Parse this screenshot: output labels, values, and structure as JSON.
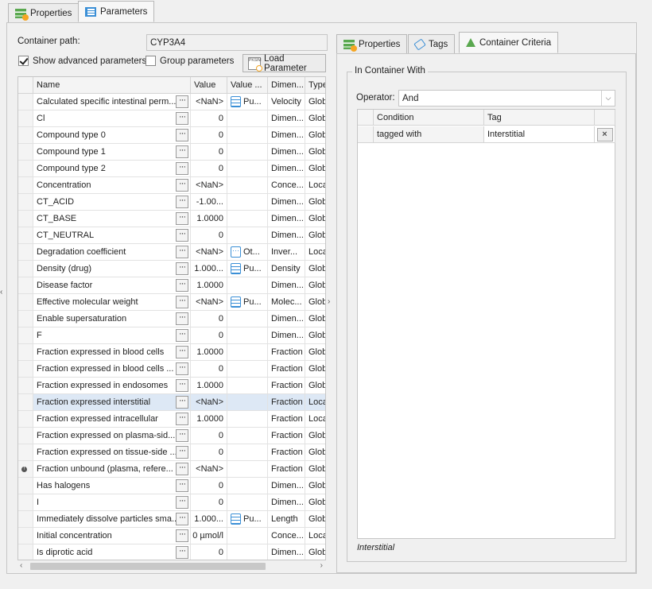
{
  "tabs": {
    "properties": "Properties",
    "parameters": "Parameters"
  },
  "container_path": {
    "label": "Container path:",
    "value": "CYP3A4"
  },
  "options": {
    "show_advanced": "Show advanced parameters",
    "group_parameters": "Group parameters",
    "load_parameter": "Load Parameter",
    "load_icon_text": "PKSIM"
  },
  "grid": {
    "columns": [
      "Name",
      "Value",
      "Value ...",
      "Dimen...",
      "Type"
    ],
    "rows": [
      {
        "name": "Calculated specific intestinal perm...",
        "value": "<NaN>",
        "origin": "Pu...",
        "origin_icon": "list",
        "dim": "Velocity",
        "type": "Globa"
      },
      {
        "name": "Cl",
        "value": "0",
        "origin": "",
        "dim": "Dimen...",
        "type": "Globa"
      },
      {
        "name": "Compound type 0",
        "value": "0",
        "origin": "",
        "dim": "Dimen...",
        "type": "Globa"
      },
      {
        "name": "Compound type 1",
        "value": "0",
        "origin": "",
        "dim": "Dimen...",
        "type": "Globa"
      },
      {
        "name": "Compound type 2",
        "value": "0",
        "origin": "",
        "dim": "Dimen...",
        "type": "Globa"
      },
      {
        "name": "Concentration",
        "value": "<NaN>",
        "origin": "",
        "dim": "Conce...",
        "type": "Loca"
      },
      {
        "name": "CT_ACID",
        "value": "-1.00...",
        "origin": "",
        "dim": "Dimen...",
        "type": "Globa"
      },
      {
        "name": "CT_BASE",
        "value": "1.0000",
        "origin": "",
        "dim": "Dimen...",
        "type": "Globa"
      },
      {
        "name": "CT_NEUTRAL",
        "value": "0",
        "origin": "",
        "dim": "Dimen...",
        "type": "Globa"
      },
      {
        "name": "Degradation coefficient",
        "value": "<NaN>",
        "origin": "Ot...",
        "origin_icon": "other",
        "dim": "Inver...",
        "type": "Loca"
      },
      {
        "name": "Density (drug)",
        "value": "1.000...",
        "origin": "Pu...",
        "origin_icon": "list",
        "dim": "Density",
        "type": "Globa"
      },
      {
        "name": "Disease factor",
        "value": "1.0000",
        "origin": "",
        "dim": "Dimen...",
        "type": "Globa"
      },
      {
        "name": "Effective molecular weight",
        "value": "<NaN>",
        "origin": "Pu...",
        "origin_icon": "list",
        "dim": "Molec...",
        "type": "Globa"
      },
      {
        "name": "Enable supersaturation",
        "value": "0",
        "origin": "",
        "dim": "Dimen...",
        "type": "Globa"
      },
      {
        "name": "F",
        "value": "0",
        "origin": "",
        "dim": "Dimen...",
        "type": "Globa"
      },
      {
        "name": "Fraction expressed in blood cells",
        "value": "1.0000",
        "origin": "",
        "dim": "Fraction",
        "type": "Globa"
      },
      {
        "name": "Fraction expressed in blood cells ...",
        "value": "0",
        "origin": "",
        "dim": "Fraction",
        "type": "Globa"
      },
      {
        "name": "Fraction expressed in endosomes",
        "value": "1.0000",
        "origin": "",
        "dim": "Fraction",
        "type": "Globa"
      },
      {
        "name": "Fraction expressed interstitial",
        "value": "<NaN>",
        "origin": "",
        "dim": "Fraction",
        "type": "Loca",
        "selected": true
      },
      {
        "name": "Fraction expressed intracellular",
        "value": "1.0000",
        "origin": "",
        "dim": "Fraction",
        "type": "Loca"
      },
      {
        "name": "Fraction expressed on plasma-sid...",
        "value": "0",
        "origin": "",
        "dim": "Fraction",
        "type": "Globa"
      },
      {
        "name": "Fraction expressed on tissue-side ...",
        "value": "0",
        "origin": "",
        "dim": "Fraction",
        "type": "Globa"
      },
      {
        "name": "Fraction unbound (plasma, refere...",
        "value": "<NaN>",
        "origin": "",
        "dim": "Fraction",
        "type": "Globa",
        "warning": true
      },
      {
        "name": "Has halogens",
        "value": "0",
        "origin": "",
        "dim": "Dimen...",
        "type": "Globa"
      },
      {
        "name": "I",
        "value": "0",
        "origin": "",
        "dim": "Dimen...",
        "type": "Globa"
      },
      {
        "name": "Immediately dissolve particles sma...",
        "value": "1.000...",
        "origin": "Pu...",
        "origin_icon": "list",
        "dim": "Length",
        "type": "Globa"
      },
      {
        "name": "Initial concentration",
        "value": "0 µmol/l",
        "origin": "",
        "dim": "Conce...",
        "type": "Loca"
      },
      {
        "name": "Is diprotic acid",
        "value": "0",
        "origin": "",
        "dim": "Dimen...",
        "type": "Globa"
      }
    ]
  },
  "right": {
    "tabs": {
      "properties": "Properties",
      "tags": "Tags",
      "criteria": "Container Criteria"
    },
    "group_title": "In Container With",
    "operator": {
      "label": "Operator:",
      "value": "And"
    },
    "criteria_columns": {
      "condition": "Condition",
      "tag": "Tag"
    },
    "criteria_rows": [
      {
        "condition": "tagged with",
        "tag": "Interstitial"
      }
    ],
    "summary": "Interstitial"
  },
  "colors": {
    "accent": "#3b8fd6",
    "selected_row": "#dde8f5",
    "green_icon": "#5aa84f"
  }
}
